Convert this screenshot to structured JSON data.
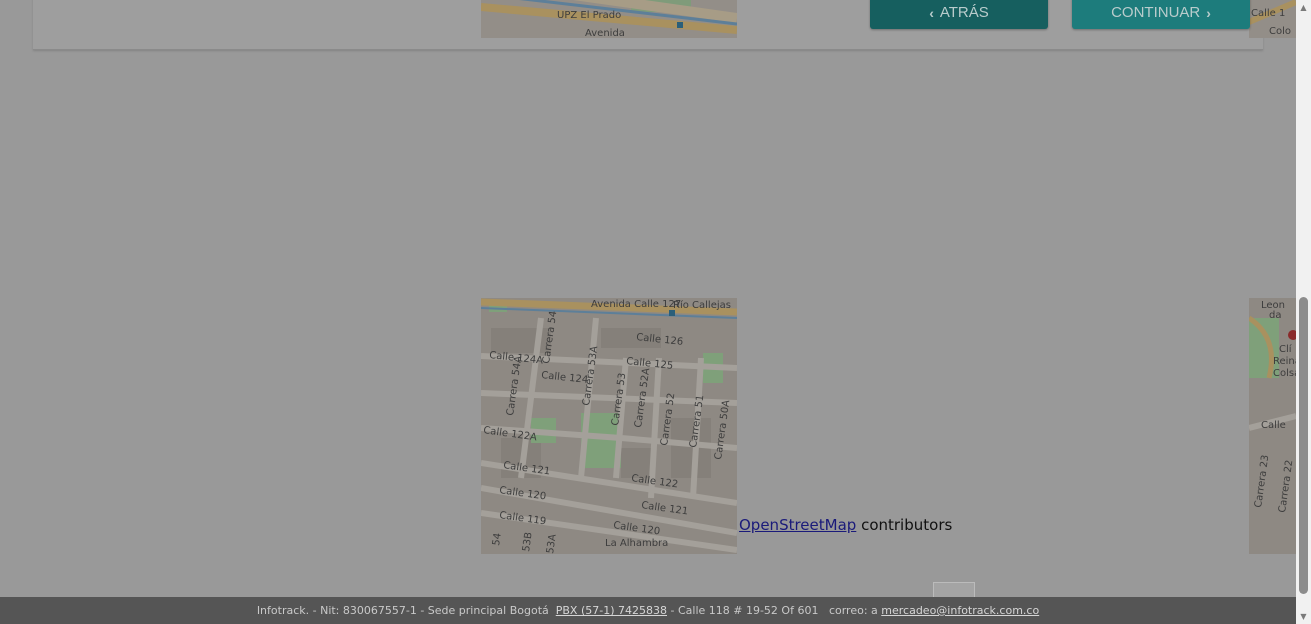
{
  "nav": {
    "back_label": "ATRÁS",
    "next_label": "CONTINUAR",
    "back_icon": "chevron-left-icon",
    "next_icon": "chevron-right-icon",
    "back_color": "#165f5f",
    "next_color": "#1d7c7c"
  },
  "map": {
    "top_labels": [
      "UPZ El Prado",
      "Avenida"
    ],
    "right_top_label": "Calle 1",
    "right_top_label2": "Colo",
    "main_labels": {
      "avenida": "Avenida Calle 127",
      "rio": "Río Callejas",
      "c126": "Calle 126",
      "c124a": "Calle 124A",
      "c125": "Calle 125",
      "c124": "Calle 124",
      "c122a": "Calle 122A",
      "c121a": "Calle 121",
      "c122": "Calle 122",
      "c120": "Calle 120",
      "c121b": "Calle 121",
      "c119": "Calle 119",
      "c120b": "Calle 120",
      "k54": "Carrera 54",
      "k54a": "Carrera 54A",
      "k53a": "Carrera 53A",
      "k53": "Carrera 53",
      "k52a": "Carrera 52A",
      "k52": "Carrera 52",
      "k51": "Carrera 51",
      "k50a": "Carrera 50A",
      "k54b": "54",
      "k53b": "53B",
      "k53c": "53A",
      "alhambra": "La Alhambra"
    },
    "right_labels": [
      "Leon",
      "da",
      "Clí",
      "Reina",
      "Colsa",
      "Calle",
      "Carrera 23",
      "Carrera 22"
    ]
  },
  "attribution": {
    "link_text": "OpenStreetMap",
    "suffix": " contributors"
  },
  "footer": {
    "company": "Infotrack. - Nit: 830067557-1 - Sede principal Bogotá  ",
    "pbx": "PBX (57-1) 7425838",
    "address": " - Calle 118 # 19-52 Of 601   correo: a ",
    "email": "mercadeo@infotrack.com.co"
  }
}
